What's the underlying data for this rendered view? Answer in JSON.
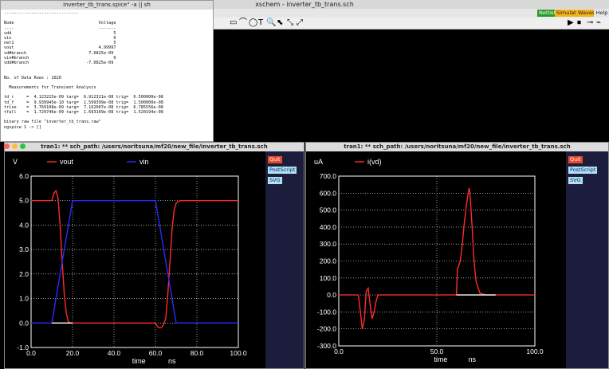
{
  "xschem": {
    "title": "xschem - inverter_tb_trans.sch",
    "menu": [
      {
        "label": "Netlist",
        "color": "#2a9a2a",
        "text": "#ffffff"
      },
      {
        "label": "Simulate",
        "color": "#f6b21b",
        "text": "#222222"
      },
      {
        "label": "Waves",
        "color": "#f6b21b",
        "text": "#222222"
      },
      {
        "label": "Help",
        "color": "#e6e6e6",
        "text": "#222222"
      }
    ]
  },
  "ngspice": {
    "title": "inverter_tb_trans.spice\" -a || sh",
    "lines": [
      "------------------------------",
      "",
      "Node                                  Voltage",
      "----                                  -------",
      "vdd                                         5",
      "vin                                         0",
      "net1                                        5",
      "vout                                  4.99997",
      "vd#branch                         7.0825e-09",
      "vin#branch                                  0",
      "vdd#branch                       -7.0825e-09",
      "",
      "",
      "No. of Data Rows : 1020",
      "",
      "  Measurements for Transient Analysis",
      "",
      "td_r     =  4.123215e-09 targ=  6.912321e-08 trig=  6.500000e-08",
      "td_f     =  9.939945e-10 targ=  1.599399e-08 trig=  1.500000e-08",
      "trise    =  3.769108e-09 targ=  7.162007e-08 trig=  6.785556e-08",
      "tfall    =  1.729746e-09 targ=  1.693169e-08 trig=  1.520194e-08",
      "",
      "binary raw file \"inverter_tb_trans.raw\"",
      "ngspice 1 -> []"
    ]
  },
  "left_window": {
    "title": "tran1: ** sch_path: /users/noritsuna/mf20/new_file/inverter_tb_trans.sch",
    "buttons": {
      "quit": "Quit",
      "postscript": "PostScript",
      "svg": "SVG"
    }
  },
  "right_window": {
    "title": "tran1: ** sch_path: /users/noritsuna/mf20/new_file/inverter_tb_trans.sch",
    "buttons": {
      "quit": "Quit",
      "postscript": "PostScript",
      "svg": "SVG"
    }
  },
  "chart_data": [
    {
      "type": "line",
      "ylabel": "V",
      "xlabel": "time",
      "xunit": "ns",
      "xlim": [
        0,
        100
      ],
      "ylim": [
        -1,
        6
      ],
      "xticks": [
        "0.0",
        "20.0",
        "40.0",
        "60.0",
        "80.0",
        "100.0"
      ],
      "yticks": [
        "-1.0",
        "0.0",
        "1.0",
        "2.0",
        "3.0",
        "4.0",
        "5.0",
        "6.0"
      ],
      "grid": true,
      "series": [
        {
          "name": "vout",
          "color": "#ff2a2a",
          "points": [
            [
              0,
              5
            ],
            [
              10,
              5
            ],
            [
              11,
              5.3
            ],
            [
              12,
              5.4
            ],
            [
              13,
              5.1
            ],
            [
              14,
              4.0
            ],
            [
              15,
              2.5
            ],
            [
              16,
              1.2
            ],
            [
              17,
              0.4
            ],
            [
              18,
              0.05
            ],
            [
              19,
              0
            ],
            [
              20,
              0
            ],
            [
              60,
              0
            ],
            [
              61,
              -0.15
            ],
            [
              62,
              -0.2
            ],
            [
              63,
              -0.18
            ],
            [
              64,
              -0.05
            ],
            [
              65,
              0.2
            ],
            [
              66,
              1.2
            ],
            [
              67,
              2.5
            ],
            [
              68,
              3.8
            ],
            [
              69,
              4.6
            ],
            [
              70,
              4.9
            ],
            [
              72,
              5
            ],
            [
              100,
              5
            ]
          ]
        },
        {
          "name": "vin",
          "color": "#2a2aff",
          "points": [
            [
              0,
              0
            ],
            [
              10,
              0
            ],
            [
              20,
              5
            ],
            [
              60,
              5
            ],
            [
              70,
              0
            ],
            [
              100,
              0
            ]
          ]
        },
        {
          "name": "",
          "color": "#ffffff",
          "points": [
            [
              10,
              0
            ],
            [
              20,
              0
            ]
          ]
        }
      ]
    },
    {
      "type": "line",
      "ylabel": "uA",
      "xlabel": "time",
      "xunit": "ns",
      "xlim": [
        0,
        100
      ],
      "ylim": [
        -300,
        700
      ],
      "xticks": [
        "0.0",
        "50.0",
        "100.0"
      ],
      "yticks": [
        "-300.0",
        "-200.0",
        "-100.0",
        "0.0",
        "100.0",
        "200.0",
        "300.0",
        "400.0",
        "500.0",
        "600.0",
        "700.0"
      ],
      "grid": true,
      "series": [
        {
          "name": "i(vd)",
          "color": "#ff2a2a",
          "points": [
            [
              0,
              0
            ],
            [
              10,
              0
            ],
            [
              11,
              -100
            ],
            [
              12,
              -200
            ],
            [
              13,
              -150
            ],
            [
              14,
              20
            ],
            [
              15,
              40
            ],
            [
              16,
              -60
            ],
            [
              17,
              -140
            ],
            [
              18,
              -100
            ],
            [
              19,
              -40
            ],
            [
              20,
              0
            ],
            [
              60,
              0
            ],
            [
              60.5,
              150
            ],
            [
              62,
              200
            ],
            [
              63,
              300
            ],
            [
              64,
              420
            ],
            [
              65,
              520
            ],
            [
              66,
              600
            ],
            [
              66.5,
              630
            ],
            [
              67,
              580
            ],
            [
              68,
              400
            ],
            [
              69,
              200
            ],
            [
              70,
              80
            ],
            [
              72,
              10
            ],
            [
              75,
              0
            ],
            [
              100,
              0
            ]
          ]
        },
        {
          "name": "",
          "color": "#ffffff",
          "points": [
            [
              60,
              0
            ],
            [
              80,
              0
            ]
          ]
        }
      ]
    }
  ]
}
